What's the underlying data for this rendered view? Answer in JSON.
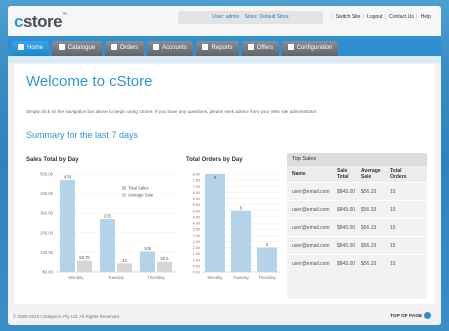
{
  "app": {
    "logo": "cstore",
    "logo_tm": "™"
  },
  "user": {
    "user_label": "User:",
    "user_value": "admin",
    "store_label": "Store:",
    "store_value": "Default Store"
  },
  "toplinks": [
    "Switch Site",
    "Logout",
    "Contact Us",
    "Help"
  ],
  "tabs": [
    {
      "label": "Home",
      "icon": "home-icon",
      "active": true
    },
    {
      "label": "Catalogue",
      "icon": "pencil-icon"
    },
    {
      "label": "Orders",
      "icon": "dollar-icon"
    },
    {
      "label": "Accounts",
      "icon": "person-icon"
    },
    {
      "label": "Reports",
      "icon": "report-icon"
    },
    {
      "label": "Offers",
      "icon": "star-icon"
    },
    {
      "label": "Configuration",
      "icon": "wrench-icon"
    }
  ],
  "main": {
    "title": "Welcome to cStore",
    "intro": "Simply click on the navigation bar above to begin using cStore. If you have any questions, please seek advice from your Web site administrator.",
    "summary_title": "Summary for the last 7 days"
  },
  "chart_data": [
    {
      "type": "bar",
      "title": "Sales Total by Day",
      "categories": [
        "Monday",
        "Tuesday",
        "Thursday"
      ],
      "series": [
        {
          "name": "Total Sales",
          "values": [
            470,
            270,
            105
          ],
          "labels": [
            "470",
            "270",
            "105"
          ],
          "color": "#b4d3e8"
        },
        {
          "name": "Average Sale",
          "values": [
            58.75,
            44,
            52.5
          ],
          "labels": [
            "58.75",
            "44",
            "52.5"
          ],
          "color": "#d6d6d6"
        }
      ],
      "ylim": [
        0,
        500
      ],
      "yticks": [
        "$0.00",
        "100.00",
        "200.00",
        "300.00",
        "400.00",
        "500.00"
      ],
      "legend": "top-right"
    },
    {
      "type": "bar",
      "title": "Total Orders by Day",
      "categories": [
        "Monday",
        "Tuesday",
        "Thursday"
      ],
      "values": [
        8,
        5,
        2
      ],
      "labels": [
        "8",
        "5",
        "2"
      ],
      "color": "#b4d3e8",
      "ylim": [
        0,
        8
      ],
      "yticks": [
        "0.00",
        "0.50",
        "1.00",
        "1.50",
        "2.00",
        "2.50",
        "3.00",
        "3.50",
        "4.00",
        "4.50",
        "5.00",
        "5.50",
        "6.00",
        "6.50",
        "7.00",
        "7.50",
        "8.00"
      ]
    }
  ],
  "top_sales": {
    "title": "Top Sales",
    "columns": [
      "Name",
      "Sale Total",
      "Average Sale",
      "Total Orders"
    ],
    "rows": [
      [
        "user@email.com",
        "$845.00",
        "$56.33",
        "15"
      ],
      [
        "user@email.com",
        "$845.00",
        "$56.33",
        "15"
      ],
      [
        "user@email.com",
        "$845.00",
        "$56.33",
        "15"
      ],
      [
        "user@email.com",
        "$845.00",
        "$56.33",
        "15"
      ],
      [
        "user@email.com",
        "$845.00",
        "$56.33",
        "15"
      ]
    ]
  },
  "footer": {
    "copyright": "© 2008-2010 Cédagenic Pty Ltd. All Rights Reserved.",
    "top_of_page": "TOP OF PAGE"
  },
  "colors": {
    "accent": "#2f95d3",
    "nav": "#2f8fd0",
    "bar": "#b4d3e8",
    "bar2": "#d6d6d6"
  }
}
